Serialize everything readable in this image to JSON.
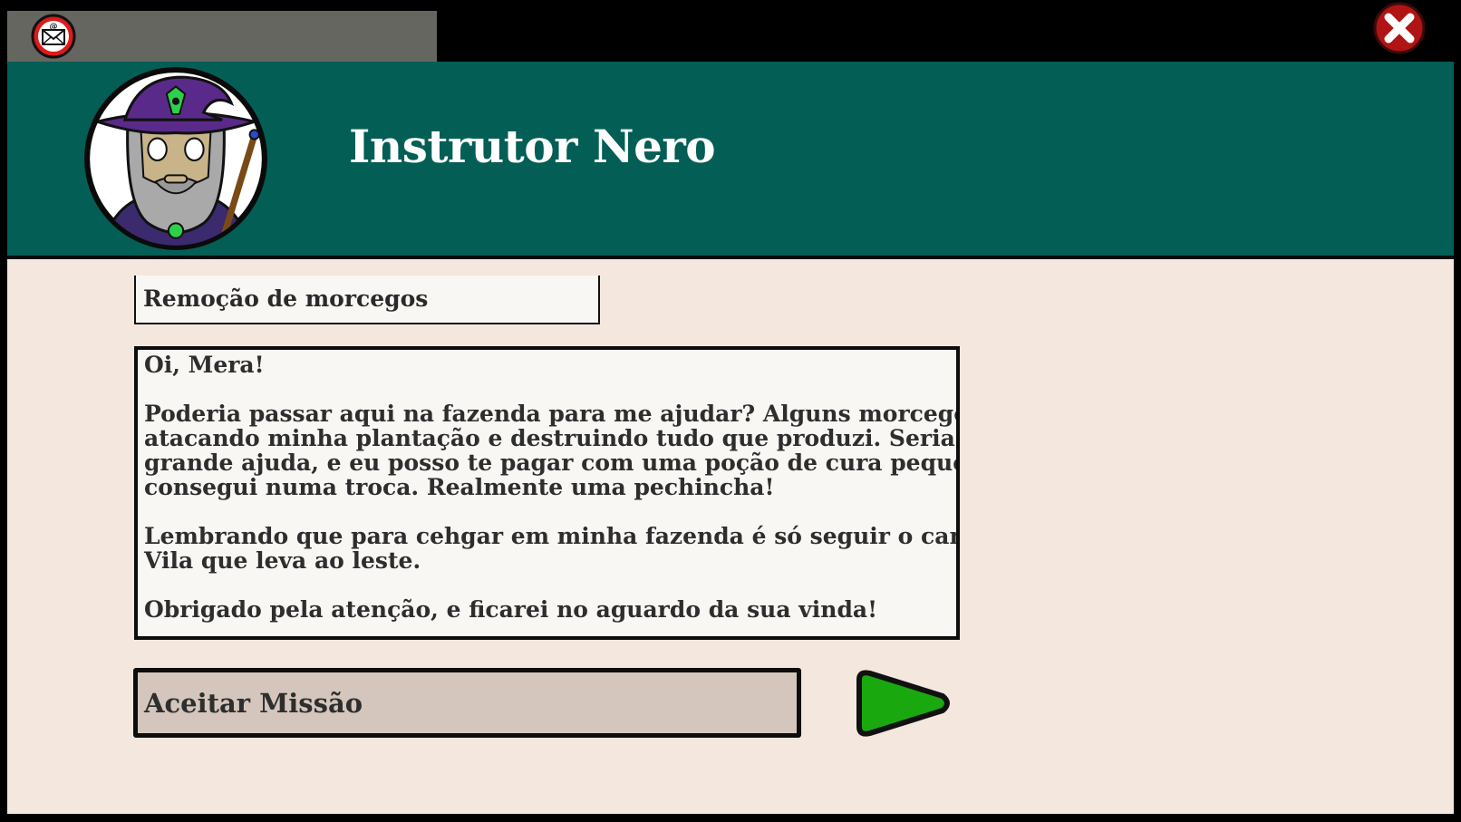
{
  "window": {
    "tab_icon": "mail-icon",
    "close_icon": "close-icon",
    "colors": {
      "header": "#035e55",
      "panel": "#f4e7de",
      "tab": "#666660",
      "accent_red": "#e01a1a",
      "go_green": "#1aa80f"
    }
  },
  "header": {
    "avatar": "wizard-portrait",
    "npc_name": "Instrutor Nero"
  },
  "quest": {
    "title": "Remoção de morcegos",
    "message": {
      "greeting": "Oi, Mera!",
      "paragraph1_line1": "Poderia passar aqui na fazenda para me ajudar? Alguns morcegos estão",
      "paragraph1_line2": "atacando minha plantação e destruindo tudo que produzi. Seria de",
      "paragraph1_line3": "grande ajuda, e eu posso te pagar com uma poção de cura pequena que",
      "paragraph1_line4": "consegui numa troca. Realmente uma pechincha!",
      "paragraph2_line1": "Lembrando que para cehgar em minha fazenda é só seguir o caminho da",
      "paragraph2_line2": "Vila que leva ao leste.",
      "closing": "Obrigado pela atenção, e ficarei no aguardo da sua vinda!"
    },
    "accept_label": "Aceitar Missão",
    "go_icon": "play-arrow-icon"
  }
}
